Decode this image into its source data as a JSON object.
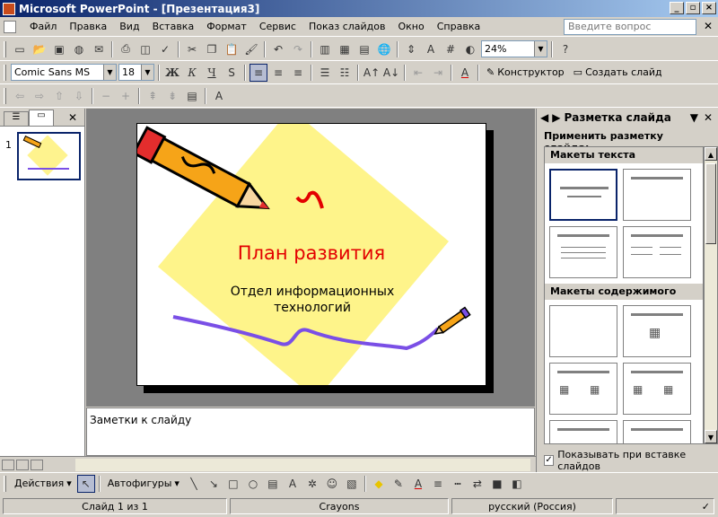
{
  "window": {
    "title": "Microsoft PowerPoint - [Презентация3]"
  },
  "menu": {
    "items": [
      "Файл",
      "Правка",
      "Вид",
      "Вставка",
      "Формат",
      "Сервис",
      "Показ слайдов",
      "Окно",
      "Справка"
    ],
    "help_placeholder": "Введите вопрос"
  },
  "toolbar": {
    "zoom": "24%",
    "font": "Comic Sans MS",
    "size": "18",
    "bold": "Ж",
    "italic": "К",
    "underline": "Ч",
    "shadow": "S",
    "designer": "Конструктор",
    "new_slide": "Создать слайд"
  },
  "slide": {
    "title": "План развития",
    "subtitle_line1": "Отдел информационных",
    "subtitle_line2": "технологий",
    "colors": {
      "title": "#e30000",
      "diamond": "#fef48a",
      "wave": "#7a4fe6",
      "pencil": "#f6a418"
    }
  },
  "outline": {
    "slide_number": "1"
  },
  "notes": {
    "placeholder": "Заметки к слайду"
  },
  "taskpane": {
    "title": "Разметка слайда",
    "apply_label": "Применить разметку слайда:",
    "group_text": "Макеты текста",
    "group_content": "Макеты содержимого",
    "checkbox_label": "Показывать при вставке слайдов"
  },
  "drawing": {
    "actions": "Действия",
    "autoshapes": "Автофигуры"
  },
  "status": {
    "slide": "Слайд 1 из 1",
    "design": "Crayons",
    "language": "русский (Россия)"
  }
}
